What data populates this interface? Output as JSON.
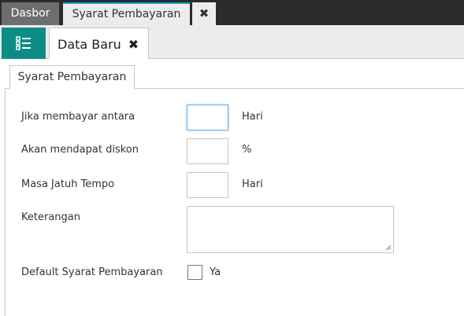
{
  "top_tabs": [
    {
      "label": "Dasbor"
    },
    {
      "label": "Syarat Pembayaran"
    }
  ],
  "top_close_icon": "✖",
  "sub_tab": {
    "label": "Data Baru",
    "close_icon": "✖"
  },
  "inner_tab": {
    "label": "Syarat Pembayaran"
  },
  "form": {
    "pay_between": {
      "label": "Jika membayar antara",
      "value": "",
      "unit": "Hari"
    },
    "discount": {
      "label": "Akan mendapat diskon",
      "value": "",
      "unit": "%"
    },
    "due": {
      "label": "Masa Jatuh Tempo",
      "value": "",
      "unit": "Hari"
    },
    "notes": {
      "label": "Keterangan",
      "value": ""
    },
    "default": {
      "label": "Default Syarat Pembayaran",
      "option": "Ya",
      "checked": false
    }
  },
  "colors": {
    "accent": "#0d8c87",
    "topbar": "#2b2b2b",
    "active_tab_border": "#19a3c7"
  }
}
